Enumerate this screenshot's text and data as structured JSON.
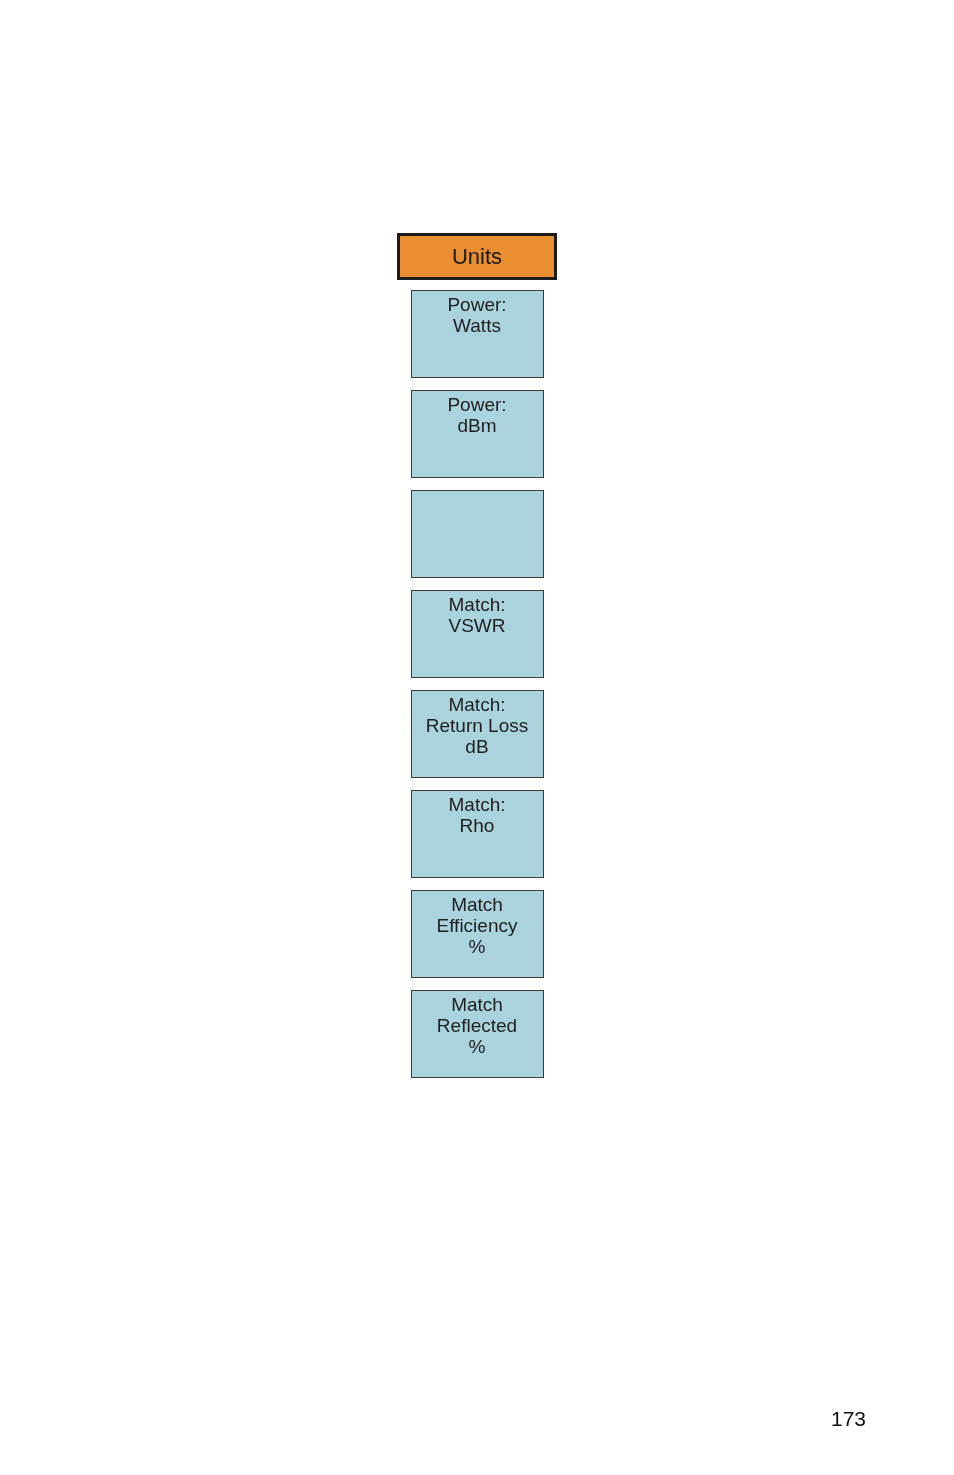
{
  "menu": {
    "title": "Units",
    "softkeys": [
      {
        "kind": "text",
        "label": "Power:\nWatts"
      },
      {
        "kind": "text",
        "label": "Power:\ndBm"
      },
      {
        "kind": "blank"
      },
      {
        "kind": "text",
        "label": "Match:\nVSWR"
      },
      {
        "kind": "text",
        "label": "Match:\nReturn Loss\ndB"
      },
      {
        "kind": "text",
        "label": "Match:\nRho"
      },
      {
        "kind": "text",
        "label": "Match\nEfficiency\n%"
      },
      {
        "kind": "text",
        "label": "Match\nReflected\n%"
      }
    ]
  },
  "page_number": "173"
}
